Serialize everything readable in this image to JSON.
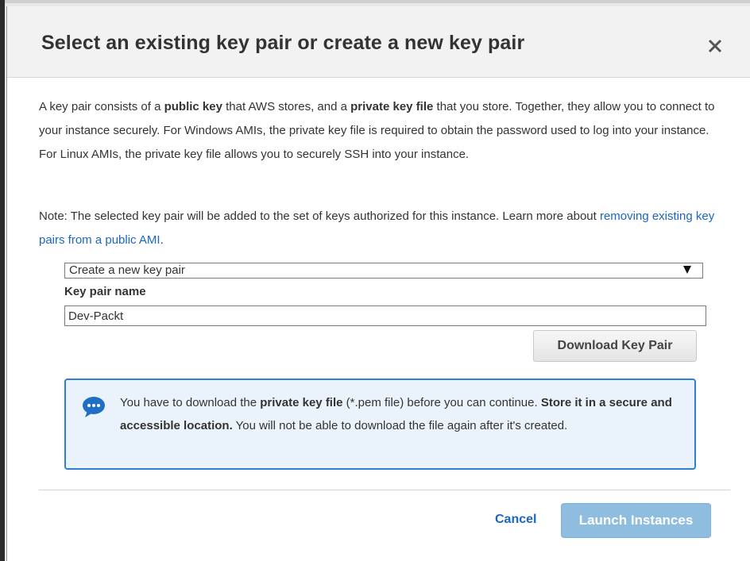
{
  "dialog": {
    "title": "Select an existing key pair or create a new key pair",
    "close_label": "×"
  },
  "intro": {
    "t1": "A key pair consists of a ",
    "b1": "public key",
    "t2": " that AWS stores, and a ",
    "b2": "private key file",
    "t3": " that you store. Together, they allow you to connect to your instance securely. For Windows AMIs, the private key file is required to obtain the password used to log into your instance. For Linux AMIs, the private key file allows you to securely SSH into your instance."
  },
  "note": {
    "t1": "Note: The selected key pair will be added to the set of keys authorized for this instance. Learn more about ",
    "link": "removing existing key pairs from a public AMI",
    "t2": "."
  },
  "key_pair_select": {
    "selected": "Create a new key pair"
  },
  "key_pair_name": {
    "label": "Key pair name",
    "value": "Dev-Packt"
  },
  "download_button": {
    "label": "Download Key Pair"
  },
  "info_box": {
    "t1": "You have to download the ",
    "b1": "private key file",
    "t2": " (*.pem file) before you can continue. ",
    "b2": "Store it in a secure and accessible location.",
    "t3": " You will not be able to download the file again after it's created.",
    "icon": "speech-bubble-icon"
  },
  "footer": {
    "cancel_label": "Cancel",
    "launch_label": "Launch Instances"
  },
  "colors": {
    "link": "#1a66c2",
    "info_border": "#2f7fd6",
    "info_bg": "#eaf3fb",
    "launch_disabled": "#8fbde0",
    "header_bg": "#f2f2f2"
  }
}
